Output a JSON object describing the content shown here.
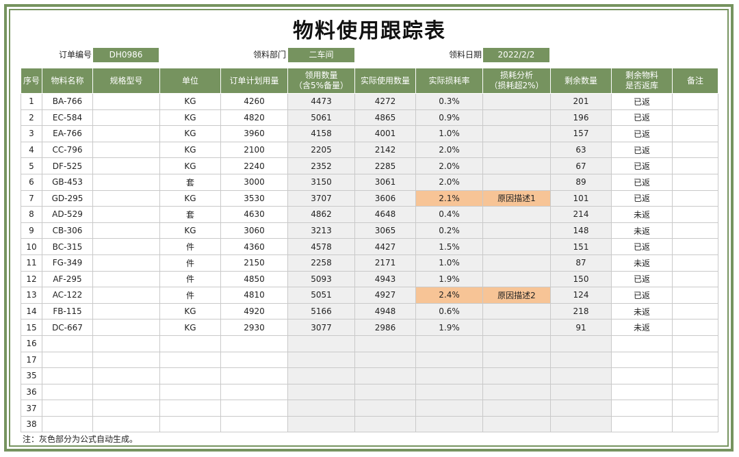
{
  "title": "物料使用跟踪表",
  "info": {
    "order_no_label": "订单编号",
    "order_no": "DH0986",
    "dept_label": "领料部门",
    "dept": "二车间",
    "date_label": "领料日期",
    "date": "2022/2/2"
  },
  "headers": [
    {
      "line1": "序号",
      "line2": ""
    },
    {
      "line1": "物料名称",
      "line2": ""
    },
    {
      "line1": "规格型号",
      "line2": ""
    },
    {
      "line1": "单位",
      "line2": ""
    },
    {
      "line1": "订单计划用量",
      "line2": ""
    },
    {
      "line1": "领用数量",
      "line2": "（含5%备量）"
    },
    {
      "line1": "实际使用数量",
      "line2": ""
    },
    {
      "line1": "实际损耗率",
      "line2": ""
    },
    {
      "line1": "损耗分析",
      "line2": "（损耗超2%）"
    },
    {
      "line1": "剩余数量",
      "line2": ""
    },
    {
      "line1": "剩余物料",
      "line2": "是否返库"
    },
    {
      "line1": "备注",
      "line2": ""
    }
  ],
  "rows": [
    {
      "no": "1",
      "name": "BA-766",
      "spec": "",
      "unit": "KG",
      "plan": "4260",
      "issued": "4473",
      "used": "4272",
      "loss": "0.3%",
      "analysis": "",
      "remain": "201",
      "returned": "已返",
      "remark": ""
    },
    {
      "no": "2",
      "name": "EC-584",
      "spec": "",
      "unit": "KG",
      "plan": "4820",
      "issued": "5061",
      "used": "4865",
      "loss": "0.9%",
      "analysis": "",
      "remain": "196",
      "returned": "已返",
      "remark": ""
    },
    {
      "no": "3",
      "name": "EA-766",
      "spec": "",
      "unit": "KG",
      "plan": "3960",
      "issued": "4158",
      "used": "4001",
      "loss": "1.0%",
      "analysis": "",
      "remain": "157",
      "returned": "已返",
      "remark": ""
    },
    {
      "no": "4",
      "name": "CC-796",
      "spec": "",
      "unit": "KG",
      "plan": "2100",
      "issued": "2205",
      "used": "2142",
      "loss": "2.0%",
      "analysis": "",
      "remain": "63",
      "returned": "已返",
      "remark": ""
    },
    {
      "no": "5",
      "name": "DF-525",
      "spec": "",
      "unit": "KG",
      "plan": "2240",
      "issued": "2352",
      "used": "2285",
      "loss": "2.0%",
      "analysis": "",
      "remain": "67",
      "returned": "已返",
      "remark": ""
    },
    {
      "no": "6",
      "name": "GB-453",
      "spec": "",
      "unit": "套",
      "plan": "3000",
      "issued": "3150",
      "used": "3061",
      "loss": "2.0%",
      "analysis": "",
      "remain": "89",
      "returned": "已返",
      "remark": ""
    },
    {
      "no": "7",
      "name": "GD-295",
      "spec": "",
      "unit": "KG",
      "plan": "3530",
      "issued": "3707",
      "used": "3606",
      "loss": "2.1%",
      "analysis": "原因描述1",
      "remain": "101",
      "returned": "已返",
      "remark": ""
    },
    {
      "no": "8",
      "name": "AD-529",
      "spec": "",
      "unit": "套",
      "plan": "4630",
      "issued": "4862",
      "used": "4648",
      "loss": "0.4%",
      "analysis": "",
      "remain": "214",
      "returned": "未返",
      "remark": ""
    },
    {
      "no": "9",
      "name": "CB-306",
      "spec": "",
      "unit": "KG",
      "plan": "3060",
      "issued": "3213",
      "used": "3065",
      "loss": "0.2%",
      "analysis": "",
      "remain": "148",
      "returned": "未返",
      "remark": ""
    },
    {
      "no": "10",
      "name": "BC-315",
      "spec": "",
      "unit": "件",
      "plan": "4360",
      "issued": "4578",
      "used": "4427",
      "loss": "1.5%",
      "analysis": "",
      "remain": "151",
      "returned": "已返",
      "remark": ""
    },
    {
      "no": "11",
      "name": "FG-349",
      "spec": "",
      "unit": "件",
      "plan": "2150",
      "issued": "2258",
      "used": "2171",
      "loss": "1.0%",
      "analysis": "",
      "remain": "87",
      "returned": "未返",
      "remark": ""
    },
    {
      "no": "12",
      "name": "AF-295",
      "spec": "",
      "unit": "件",
      "plan": "4850",
      "issued": "5093",
      "used": "4943",
      "loss": "1.9%",
      "analysis": "",
      "remain": "150",
      "returned": "已返",
      "remark": ""
    },
    {
      "no": "13",
      "name": "AC-122",
      "spec": "",
      "unit": "件",
      "plan": "4810",
      "issued": "5051",
      "used": "4927",
      "loss": "2.4%",
      "analysis": "原因描述2",
      "remain": "124",
      "returned": "已返",
      "remark": ""
    },
    {
      "no": "14",
      "name": "FB-115",
      "spec": "",
      "unit": "KG",
      "plan": "4920",
      "issued": "5166",
      "used": "4948",
      "loss": "0.6%",
      "analysis": "",
      "remain": "218",
      "returned": "未返",
      "remark": ""
    },
    {
      "no": "15",
      "name": "DC-667",
      "spec": "",
      "unit": "KG",
      "plan": "2930",
      "issued": "3077",
      "used": "2986",
      "loss": "1.9%",
      "analysis": "",
      "remain": "91",
      "returned": "未返",
      "remark": ""
    },
    {
      "no": "16",
      "name": "",
      "spec": "",
      "unit": "",
      "plan": "",
      "issued": "",
      "used": "",
      "loss": "",
      "analysis": "",
      "remain": "",
      "returned": "",
      "remark": ""
    },
    {
      "no": "17",
      "name": "",
      "spec": "",
      "unit": "",
      "plan": "",
      "issued": "",
      "used": "",
      "loss": "",
      "analysis": "",
      "remain": "",
      "returned": "",
      "remark": ""
    },
    {
      "no": "35",
      "name": "",
      "spec": "",
      "unit": "",
      "plan": "",
      "issued": "",
      "used": "",
      "loss": "",
      "analysis": "",
      "remain": "",
      "returned": "",
      "remark": ""
    },
    {
      "no": "36",
      "name": "",
      "spec": "",
      "unit": "",
      "plan": "",
      "issued": "",
      "used": "",
      "loss": "",
      "analysis": "",
      "remain": "",
      "returned": "",
      "remark": ""
    },
    {
      "no": "37",
      "name": "",
      "spec": "",
      "unit": "",
      "plan": "",
      "issued": "",
      "used": "",
      "loss": "",
      "analysis": "",
      "remain": "",
      "returned": "",
      "remark": ""
    },
    {
      "no": "38",
      "name": "",
      "spec": "",
      "unit": "",
      "plan": "",
      "issued": "",
      "used": "",
      "loss": "",
      "analysis": "",
      "remain": "",
      "returned": "",
      "remark": ""
    }
  ],
  "note": "注：灰色部分为公式自动生成。",
  "colors": {
    "header_green": "#76935f",
    "formula_gray": "#efefef",
    "highlight_orange": "#f7c496"
  }
}
